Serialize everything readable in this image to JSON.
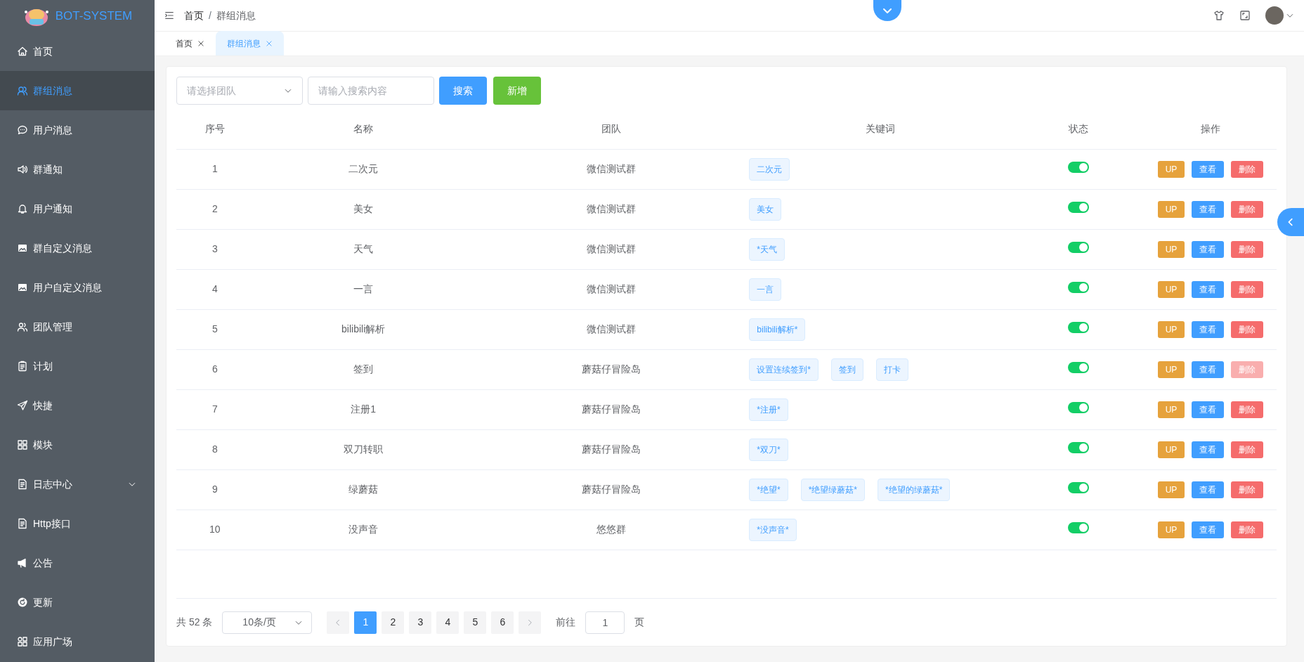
{
  "sidebar": {
    "logo_text": "BOT-SYSTEM",
    "items": [
      {
        "label": "首页",
        "selected": false
      },
      {
        "label": "群组消息",
        "selected": true
      },
      {
        "label": "用户消息",
        "selected": false
      },
      {
        "label": "群通知",
        "selected": false
      },
      {
        "label": "用户通知",
        "selected": false
      },
      {
        "label": "群自定义消息",
        "selected": false
      },
      {
        "label": "用户自定义消息",
        "selected": false
      },
      {
        "label": "团队管理",
        "selected": false
      },
      {
        "label": "计划",
        "selected": false
      },
      {
        "label": "快捷",
        "selected": false
      },
      {
        "label": "模块",
        "selected": false
      },
      {
        "label": "日志中心",
        "selected": false,
        "expanded": false
      },
      {
        "label": "Http接口",
        "selected": false
      },
      {
        "label": "公告",
        "selected": false
      },
      {
        "label": "更新",
        "selected": false
      },
      {
        "label": "应用广场",
        "selected": false
      }
    ]
  },
  "breadcrumb": [
    "首页",
    "群组消息"
  ],
  "breadcrumb_separator": "/",
  "tabs": [
    {
      "label": "首页",
      "selected": false
    },
    {
      "label": "群组消息",
      "selected": true
    }
  ],
  "filters": {
    "team_placeholder": "请选择团队",
    "search_placeholder": "请输入搜索内容",
    "search_button": "搜索",
    "add_button": "新增"
  },
  "table": {
    "columns": [
      "序号",
      "名称",
      "团队",
      "关键词",
      "状态",
      "操作"
    ],
    "rows": [
      {
        "index": "1",
        "name": "二次元",
        "team": "微信测试群",
        "keywords": [
          "二次元"
        ],
        "enabled": true,
        "actions": [
          {
            "label": "UP",
            "kind": "up",
            "disabled": false
          },
          {
            "label": "查看",
            "kind": "view",
            "disabled": false
          },
          {
            "label": "删除",
            "kind": "delete",
            "disabled": false
          }
        ]
      },
      {
        "index": "2",
        "name": "美女",
        "team": "微信测试群",
        "keywords": [
          "美女"
        ],
        "enabled": true,
        "actions": [
          {
            "label": "UP",
            "kind": "up",
            "disabled": false
          },
          {
            "label": "查看",
            "kind": "view",
            "disabled": false
          },
          {
            "label": "删除",
            "kind": "delete",
            "disabled": false
          }
        ]
      },
      {
        "index": "3",
        "name": "天气",
        "team": "微信测试群",
        "keywords": [
          "*天气"
        ],
        "enabled": true,
        "actions": [
          {
            "label": "UP",
            "kind": "up",
            "disabled": false
          },
          {
            "label": "查看",
            "kind": "view",
            "disabled": false
          },
          {
            "label": "删除",
            "kind": "delete",
            "disabled": false
          }
        ]
      },
      {
        "index": "4",
        "name": "一言",
        "team": "微信测试群",
        "keywords": [
          "一言"
        ],
        "enabled": true,
        "actions": [
          {
            "label": "UP",
            "kind": "up",
            "disabled": false
          },
          {
            "label": "查看",
            "kind": "view",
            "disabled": false
          },
          {
            "label": "删除",
            "kind": "delete",
            "disabled": false
          }
        ]
      },
      {
        "index": "5",
        "name": "bilibili解析",
        "team": "微信测试群",
        "keywords": [
          "bilibili解析*"
        ],
        "enabled": true,
        "actions": [
          {
            "label": "UP",
            "kind": "up",
            "disabled": false
          },
          {
            "label": "查看",
            "kind": "view",
            "disabled": false
          },
          {
            "label": "删除",
            "kind": "delete",
            "disabled": false
          }
        ]
      },
      {
        "index": "6",
        "name": "签到",
        "team": "蘑菇仔冒险岛",
        "keywords": [
          "设置连续签到*",
          "签到",
          "打卡"
        ],
        "enabled": true,
        "actions": [
          {
            "label": "UP",
            "kind": "up",
            "disabled": false
          },
          {
            "label": "查看",
            "kind": "view",
            "disabled": false
          },
          {
            "label": "删除",
            "kind": "delete",
            "disabled": true
          }
        ]
      },
      {
        "index": "7",
        "name": "注册1",
        "team": "蘑菇仔冒险岛",
        "keywords": [
          "*注册*"
        ],
        "enabled": true,
        "actions": [
          {
            "label": "UP",
            "kind": "up",
            "disabled": false
          },
          {
            "label": "查看",
            "kind": "view",
            "disabled": false
          },
          {
            "label": "删除",
            "kind": "delete",
            "disabled": false
          }
        ]
      },
      {
        "index": "8",
        "name": "双刀转职",
        "team": "蘑菇仔冒险岛",
        "keywords": [
          "*双刀*"
        ],
        "enabled": true,
        "actions": [
          {
            "label": "UP",
            "kind": "up",
            "disabled": false
          },
          {
            "label": "查看",
            "kind": "view",
            "disabled": false
          },
          {
            "label": "删除",
            "kind": "delete",
            "disabled": false
          }
        ]
      },
      {
        "index": "9",
        "name": "绿蘑菇",
        "team": "蘑菇仔冒险岛",
        "keywords": [
          "*绝望*",
          "*绝望绿蘑菇*",
          "*绝望的绿蘑菇*"
        ],
        "enabled": true,
        "actions": [
          {
            "label": "UP",
            "kind": "up",
            "disabled": false
          },
          {
            "label": "查看",
            "kind": "view",
            "disabled": false
          },
          {
            "label": "删除",
            "kind": "delete",
            "disabled": false
          }
        ]
      },
      {
        "index": "10",
        "name": "没声音",
        "team": "悠悠群",
        "keywords": [
          "*没声音*"
        ],
        "enabled": true,
        "actions": [
          {
            "label": "UP",
            "kind": "up",
            "disabled": false
          },
          {
            "label": "查看",
            "kind": "view",
            "disabled": false
          },
          {
            "label": "删除",
            "kind": "delete",
            "disabled": false
          }
        ]
      }
    ]
  },
  "pagination": {
    "total": "共 52 条",
    "page_size": "10条/页",
    "pages": [
      {
        "label": "1",
        "selected": true
      },
      {
        "label": "2",
        "selected": false
      },
      {
        "label": "3",
        "selected": false
      },
      {
        "label": "4",
        "selected": false
      },
      {
        "label": "5",
        "selected": false
      },
      {
        "label": "6",
        "selected": false
      }
    ],
    "goto_label": "前往",
    "goto_value": "1",
    "goto_suffix": "页"
  }
}
